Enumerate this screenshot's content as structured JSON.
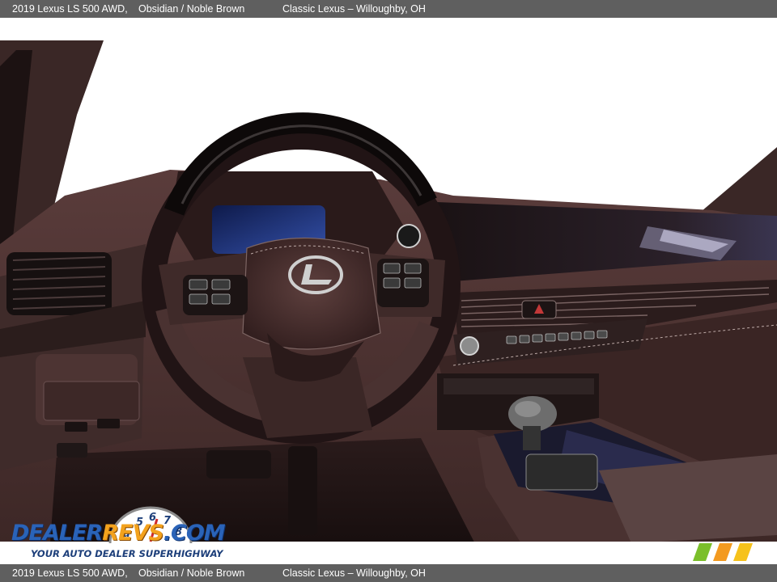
{
  "caption": {
    "vehicle": "2019 Lexus LS 500 AWD,",
    "colors": "Obsidian / Noble Brown",
    "dealer": "Classic Lexus – Willoughby, OH"
  },
  "watermark": {
    "brand_part1": "Dealer",
    "brand_part2": "Revs",
    "brand_suffix": ".com",
    "tagline": "Your Auto Dealer SuperHighway",
    "gauge_digits": "a 5 6 7 8"
  },
  "scene": {
    "subject": "Lexus dashboard and steering wheel interior",
    "emblem": "lexus-l-logo"
  },
  "colors": {
    "caption_bar": "#5f5f5f",
    "leather": "#4a3130",
    "leather_dark": "#2a1a1a",
    "trim": "#6e5655",
    "logo_blue": "#2a63b8",
    "logo_orange": "#f3a21d",
    "stripe_green": "#7bbf2a",
    "stripe_orange": "#f39a1f",
    "stripe_yellow": "#f6c21b"
  }
}
